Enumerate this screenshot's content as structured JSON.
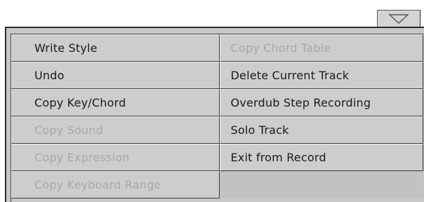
{
  "dropdown": {
    "icon": "triangle-down-icon"
  },
  "menu": {
    "left": [
      {
        "label": "Write Style",
        "enabled": true
      },
      {
        "label": "Undo",
        "enabled": true
      },
      {
        "label": "Copy Key/Chord",
        "enabled": true
      },
      {
        "label": "Copy Sound",
        "enabled": false
      },
      {
        "label": "Copy Expression",
        "enabled": false
      },
      {
        "label": "Copy Keyboard Range",
        "enabled": false
      }
    ],
    "right": [
      {
        "label": "Copy Chord Table",
        "enabled": false
      },
      {
        "label": "Delete Current Track",
        "enabled": true
      },
      {
        "label": "Overdub Step Recording",
        "enabled": true
      },
      {
        "label": "Solo Track",
        "enabled": true
      },
      {
        "label": "Exit from Record",
        "enabled": true
      }
    ]
  }
}
